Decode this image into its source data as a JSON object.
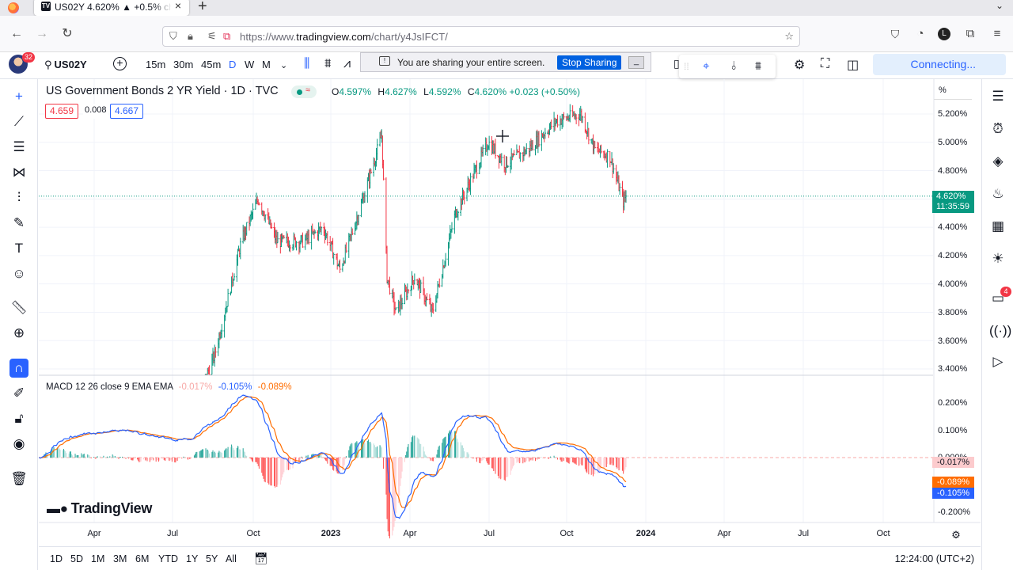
{
  "browser": {
    "tab_title": "US02Y 4.620% ▲ +0.5% cha",
    "tab_favicon": "TV",
    "url_prefix": "https://www.",
    "url_domain": "tradingview.com",
    "url_path": "/chart/y4JsIFCT/"
  },
  "tv_header": {
    "avatar_badge": "32",
    "symbol": "US02Y",
    "intervals": [
      "15m",
      "30m",
      "45m",
      "D",
      "W",
      "M"
    ],
    "active_interval": "D",
    "connecting": "Connecting..."
  },
  "share": {
    "message": "You are sharing your entire screen.",
    "stop_label": "Stop Sharing",
    "min_label": "_"
  },
  "legend": {
    "title": "US Government Bonds 2 YR Yield · 1D · TVC",
    "ohlc": [
      {
        "k": "O",
        "v": "4.597%"
      },
      {
        "k": "H",
        "v": "4.627%"
      },
      {
        "k": "L",
        "v": "4.592%"
      },
      {
        "k": "C",
        "v": "4.620% +0.023 (+0.50%)"
      }
    ],
    "sell": "4.659",
    "spread": "0.008",
    "buy": "4.667"
  },
  "price_axis": {
    "mode": "%",
    "labels": [
      "5.200%",
      "5.000%",
      "4.800%",
      "4.400%",
      "4.200%",
      "4.000%",
      "3.800%",
      "3.600%",
      "3.400%"
    ],
    "last_price": "4.620%",
    "countdown": "11:35:59"
  },
  "macd": {
    "name": "MACD",
    "params": "12 26 close 9 EMA EMA",
    "hist": "-0.017%",
    "macd": "-0.105%",
    "signal": "-0.089%",
    "axis_labels": [
      "0.200%",
      "0.100%",
      "-0.200%"
    ],
    "zero_label": "0.000%"
  },
  "time_axis": {
    "labels": [
      {
        "t": "Apr",
        "bold": false
      },
      {
        "t": "Jul",
        "bold": false
      },
      {
        "t": "Oct",
        "bold": false
      },
      {
        "t": "2023",
        "bold": true
      },
      {
        "t": "Apr",
        "bold": false
      },
      {
        "t": "Jul",
        "bold": false
      },
      {
        "t": "Oct",
        "bold": false
      },
      {
        "t": "2024",
        "bold": true
      },
      {
        "t": "Apr",
        "bold": false
      },
      {
        "t": "Jul",
        "bold": false
      },
      {
        "t": "Oct",
        "bold": false
      }
    ]
  },
  "watermark": "TradingView",
  "bottom": {
    "ranges": [
      "1D",
      "5D",
      "1M",
      "3M",
      "6M",
      "YTD",
      "1Y",
      "5Y",
      "All"
    ],
    "clock": "12:24:00 (UTC+2)"
  },
  "right_badge": "4",
  "colors": {
    "up": "#089981",
    "down": "#f23645",
    "accent": "#2962ff",
    "signal": "#ff6d00"
  },
  "chart_data": {
    "type": "candlestick",
    "title": "US Government Bonds 2 YR Yield · 1D · TVC",
    "y_unit": "%",
    "ylim": [
      3.35,
      5.3
    ],
    "x_start": "2022-02-15",
    "x_end": "2023-12-08",
    "close_path": [
      [
        "2022-02-15",
        1.55
      ],
      [
        "2022-06-01",
        2.6
      ],
      [
        "2022-08-01",
        3.0
      ],
      [
        "2022-09-01",
        3.5
      ],
      [
        "2022-10-01",
        4.3
      ],
      [
        "2022-10-20",
        4.6
      ],
      [
        "2022-11-10",
        4.3
      ],
      [
        "2022-12-10",
        4.3
      ],
      [
        "2023-01-01",
        4.4
      ],
      [
        "2023-01-20",
        4.1
      ],
      [
        "2023-02-15",
        4.6
      ],
      [
        "2023-03-08",
        5.05
      ],
      [
        "2023-03-14",
        4.05
      ],
      [
        "2023-03-24",
        3.8
      ],
      [
        "2023-04-14",
        4.05
      ],
      [
        "2023-05-04",
        3.8
      ],
      [
        "2023-05-30",
        4.5
      ],
      [
        "2023-07-06",
        5.0
      ],
      [
        "2023-07-25",
        4.85
      ],
      [
        "2023-08-20",
        4.95
      ],
      [
        "2023-09-20",
        5.15
      ],
      [
        "2023-10-18",
        5.2
      ],
      [
        "2023-11-03",
        4.95
      ],
      [
        "2023-11-20",
        4.9
      ],
      [
        "2023-12-05",
        4.58
      ],
      [
        "2023-12-08",
        4.62
      ]
    ],
    "last": 4.62,
    "macd": {
      "params": "12 26 close 9 EMA EMA",
      "ylim": [
        -0.23,
        0.28
      ],
      "last_hist": -0.017,
      "last_macd": -0.105,
      "last_signal": -0.089
    }
  }
}
